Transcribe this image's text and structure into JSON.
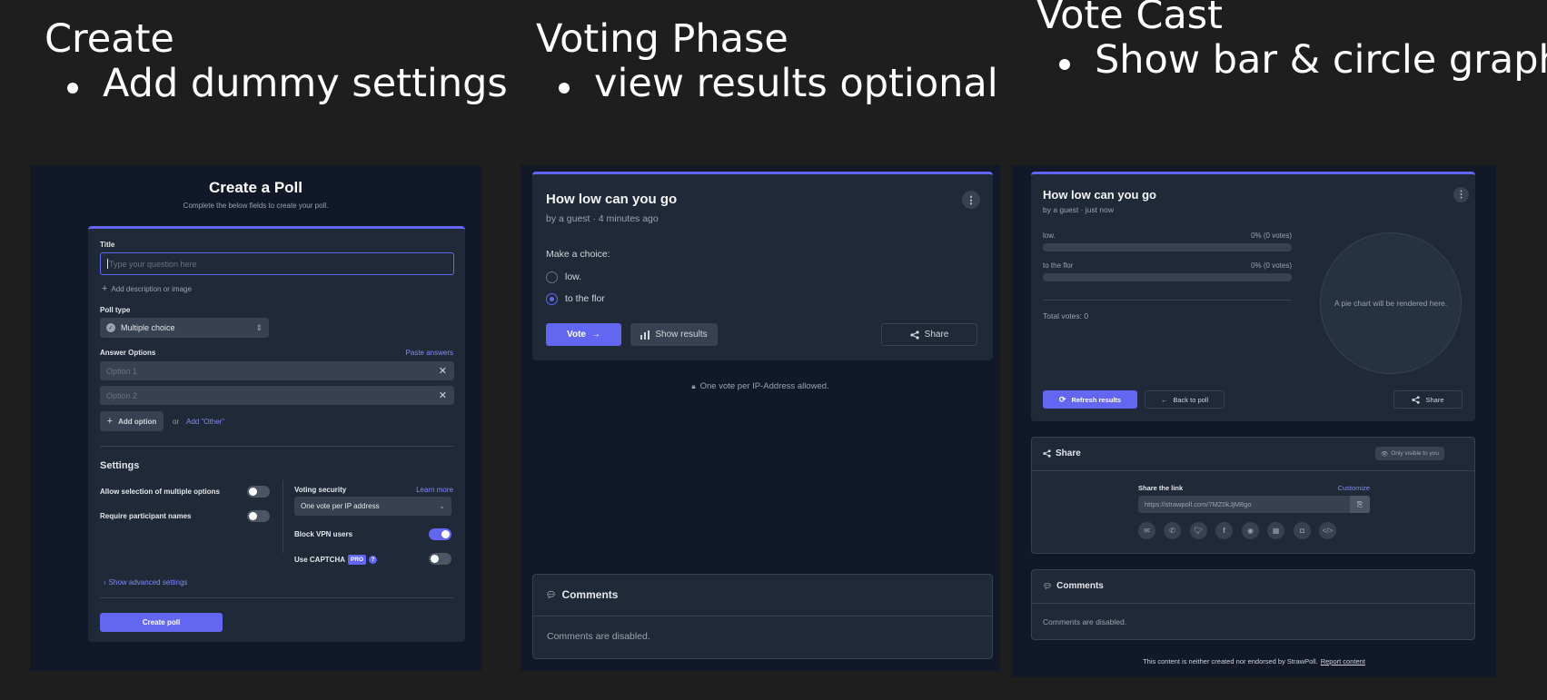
{
  "headings": {
    "create": {
      "title": "Create",
      "bullet": "Add dummy settings"
    },
    "voting": {
      "title": "Voting Phase",
      "bullet": "view results optional"
    },
    "cast": {
      "title": "Vote Cast",
      "bullet": "Show bar & circle graph"
    }
  },
  "create_poll": {
    "title": "Create a Poll",
    "subtitle": "Complete the below fields to create your poll.",
    "title_label": "Title",
    "title_placeholder": "Type your question here",
    "add_description": "Add description or image",
    "poll_type_label": "Poll type",
    "poll_type_value": "Multiple choice",
    "answer_options_label": "Answer Options",
    "paste_answers": "Paste answers",
    "options": [
      {
        "placeholder": "Option 1"
      },
      {
        "placeholder": "Option 2"
      }
    ],
    "add_option": "Add option",
    "or_text": "or",
    "add_other": "Add \"Other\"",
    "settings_heading": "Settings",
    "allow_multiple": "Allow selection of multiple options",
    "require_names": "Require participant names",
    "voting_security_label": "Voting security",
    "learn_more": "Learn more",
    "voting_security_value": "One vote per IP address",
    "block_vpn": "Block VPN users",
    "use_captcha": "Use CAPTCHA",
    "pro_badge": "PRO",
    "help": "?",
    "show_advanced": "Show advanced settings",
    "create_button": "Create poll",
    "toggles": {
      "allow_multiple": false,
      "require_names": false,
      "block_vpn": true,
      "captcha": false
    }
  },
  "voting_phase": {
    "poll_title": "How low can you go",
    "meta": "by a guest · 4 minutes ago",
    "prompt": "Make a choice:",
    "choices": [
      {
        "label": "low.",
        "selected": false
      },
      {
        "label": "to the flor",
        "selected": true
      }
    ],
    "vote_button": "Vote",
    "show_results": "Show results",
    "share": "Share",
    "notice": "One vote per IP-Address allowed.",
    "comments_title": "Comments",
    "comments_disabled": "Comments are disabled."
  },
  "vote_cast": {
    "poll_title": "How low can you go",
    "meta": "by a guest · just now",
    "results": [
      {
        "label": "low.",
        "value": "0% (0 votes)",
        "percent": 0
      },
      {
        "label": "to the flor",
        "value": "0% (0 votes)",
        "percent": 0
      }
    ],
    "total_votes": "Total votes: 0",
    "pie_placeholder": "A pie chart will be rendered here.",
    "refresh_results": "Refresh results",
    "back_to_poll": "Back to poll",
    "share": "Share",
    "share_section_title": "Share",
    "only_visible": "Only visible to you",
    "share_link_label": "Share the link",
    "customize": "Customize",
    "share_url": "https://strawpoll.com/7MZ0kJjM8go",
    "comments_title": "Comments",
    "comments_disabled": "Comments are disabled.",
    "footer_text": "This content is neither created nor endorsed by StrawPoll.",
    "report_content": "Report content"
  },
  "colors": {
    "accent": "#6366f1",
    "page_bg": "#1e1e1e",
    "panel_bg": "#111827",
    "card_bg": "#1f2937"
  }
}
